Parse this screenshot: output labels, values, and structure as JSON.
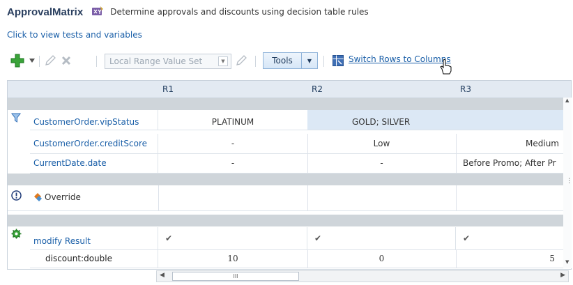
{
  "header": {
    "title": "ApprovalMatrix",
    "description": "Determine approvals and discounts using decision table rules",
    "tests_link": "Click to view tests and variables"
  },
  "toolbar": {
    "range_select_value": "Local Range Value Set",
    "tools_label": "Tools",
    "switch_label": "Switch Rows to Columns"
  },
  "columns": [
    "R1",
    "R2",
    "R3"
  ],
  "conditions": [
    {
      "label": "CustomerOrder.vipStatus",
      "values": [
        "PLATINUM",
        "GOLD; SILVER",
        ""
      ]
    },
    {
      "label": "CustomerOrder.creditScore",
      "values": [
        "-",
        "Low",
        "Medium"
      ]
    },
    {
      "label": "CurrentDate.date",
      "values": [
        "-",
        "-",
        "Before Promo; After Pr"
      ]
    }
  ],
  "override": {
    "label": "Override"
  },
  "action": {
    "label": "modify Result",
    "check": "✔",
    "param_label": "discount:double",
    "param_values": [
      "10",
      "0",
      "5"
    ]
  },
  "scrollbar": {
    "thumb_glyph": "III"
  },
  "colors": {
    "link": "#1a5fa8",
    "header_bg": "#e3eaf2",
    "band_bg": "#cfd5da",
    "highlight": "#dce8f5",
    "add_green": "#3aa339"
  }
}
